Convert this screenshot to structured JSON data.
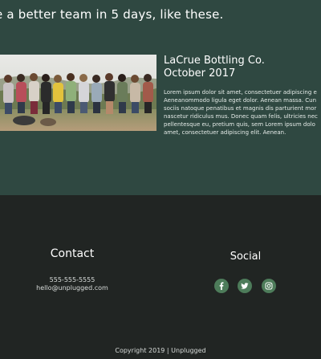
{
  "hero": {
    "title": "e a better team in 5 days, like these."
  },
  "case_study": {
    "company": "LaCrue Bottling Co.",
    "date": "October 2017",
    "description_lines": [
      "Lorem ipsum dolor sit amet, consectetuer adipiscing e",
      "Aeneanommodo ligula eget dolor. Aenean massa. Cun",
      "sociis natoque penatibus et magnis dis parturient mor",
      "nascetur ridiculus mus. Donec quam felis, ultricies nec",
      "pellentesque eu, pretium quis, sem Lorem ipsum dolo",
      "amet, consectetuer adipiscing elit. Aenean."
    ]
  },
  "contact": {
    "heading": "Contact",
    "phone": "555-555-5555",
    "email": "hello@unplugged.com"
  },
  "social": {
    "heading": "Social",
    "icons": [
      "facebook-icon",
      "twitter-icon",
      "instagram-icon"
    ]
  },
  "footer": {
    "copyright": "Copyright 2019 | Unplugged"
  },
  "colors": {
    "hero_bg": "#2f4841",
    "footer_bg": "#212523",
    "social_icon_bg": "#4d7c5a"
  }
}
